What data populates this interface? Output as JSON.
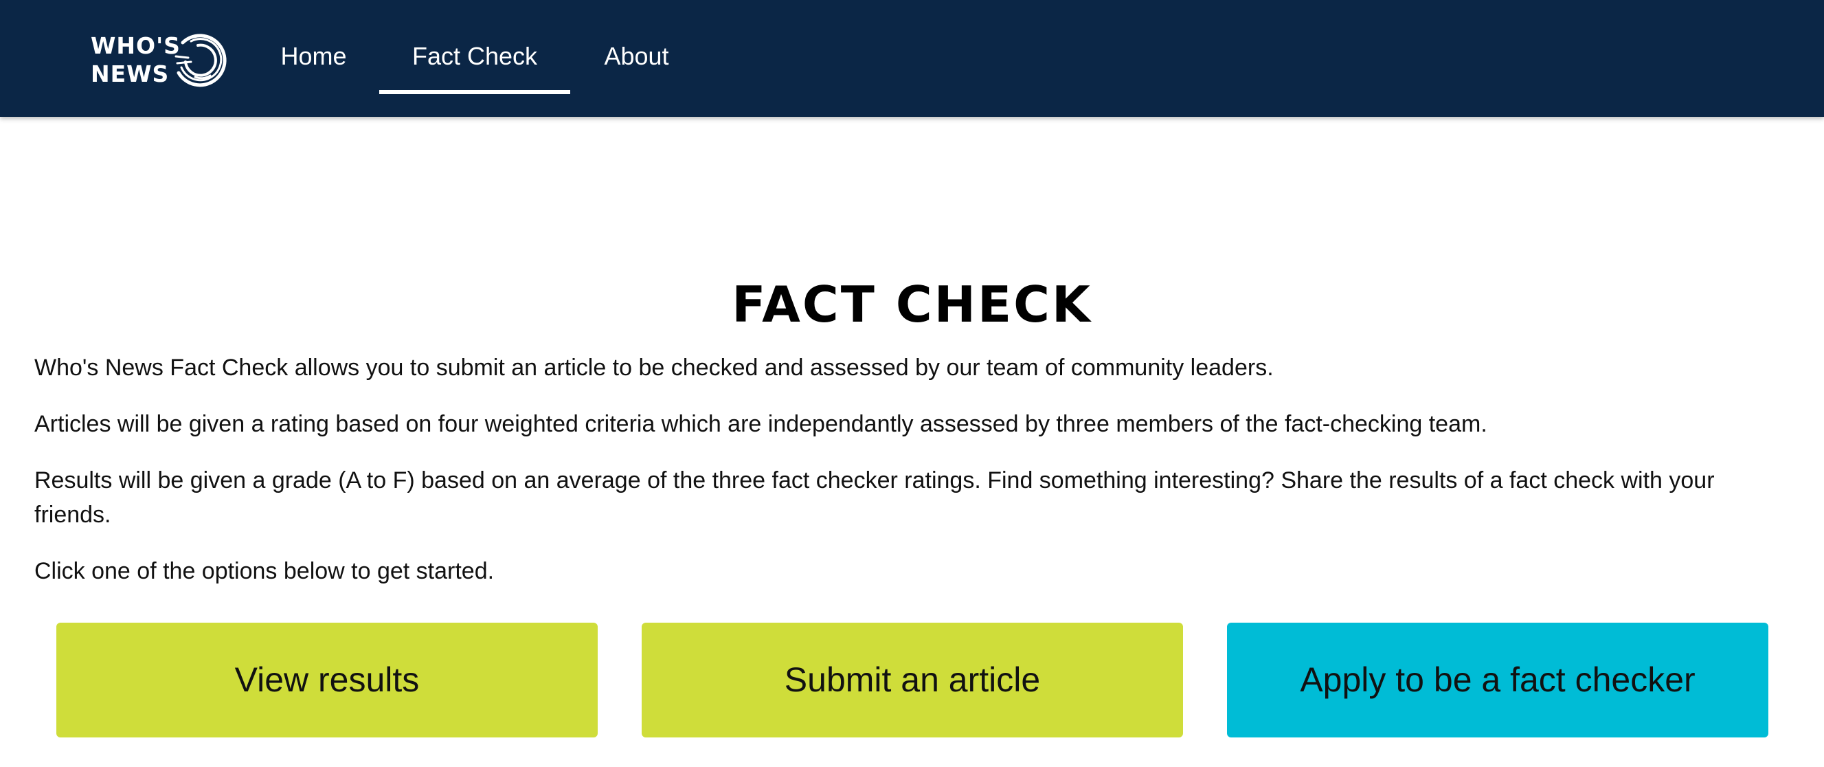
{
  "brand": {
    "logo_line1": "WHO'S",
    "logo_line2": "NEWS"
  },
  "nav": {
    "items": [
      {
        "label": "Home",
        "active": false
      },
      {
        "label": "Fact Check",
        "active": true
      },
      {
        "label": "About",
        "active": false
      }
    ]
  },
  "main": {
    "title": "FACT CHECK",
    "paragraphs": [
      "Who's News Fact Check allows you to submit an article to be checked and assessed by our team of community leaders.",
      "Articles will be given a rating based on four weighted criteria which are independantly assessed by three members of the fact-checking team.",
      "Results will be given a grade (A to F) based on an average of the three fact checker ratings. Find something interesting? Share the results of a fact check with your friends.",
      "Click one of the options below to get started."
    ]
  },
  "actions": {
    "view_results": "View results",
    "submit_article": "Submit an article",
    "apply_checker": "Apply to be a fact checker"
  },
  "colors": {
    "navbar": "#0b2646",
    "primary_button": "#cfdd3a",
    "accent_button": "#00bcd6"
  },
  "icons": {
    "logo": "swirl-ring-icon"
  }
}
